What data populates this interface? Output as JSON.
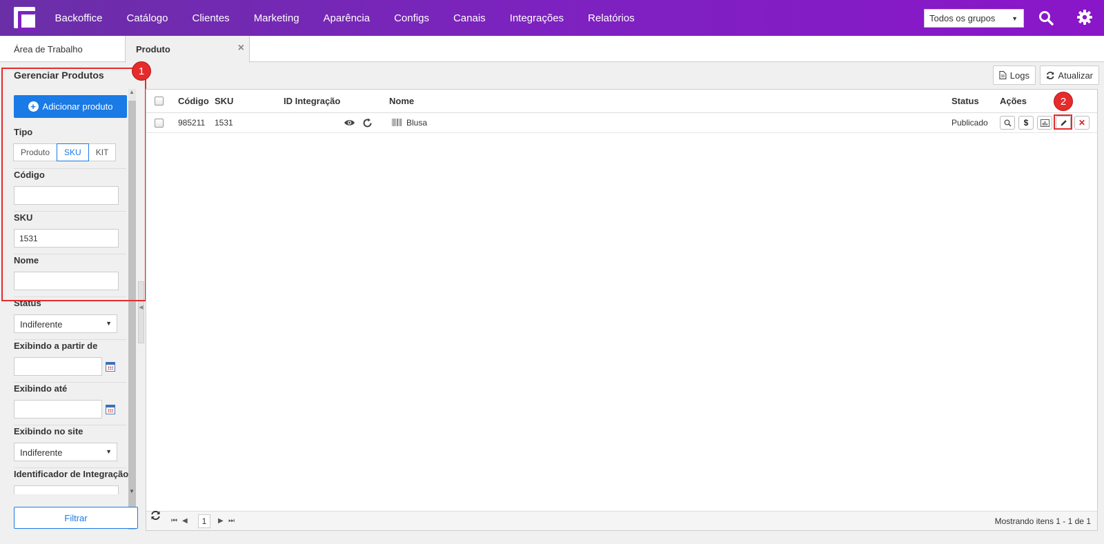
{
  "topnav": {
    "items": [
      "Backoffice",
      "Catálogo",
      "Clientes",
      "Marketing",
      "Aparência",
      "Configs",
      "Canais",
      "Integrações",
      "Relatórios"
    ],
    "group_select": "Todos os grupos",
    "icons": [
      "logo-icon",
      "search-icon",
      "gear-icon"
    ]
  },
  "tabs": [
    {
      "label": "Área de Trabalho"
    },
    {
      "label": "Produto",
      "active": true,
      "close": "×"
    }
  ],
  "sidebar": {
    "title": "Gerenciar Produtos",
    "add_button": "Adicionar produto",
    "tipo_label": "Tipo",
    "tipo_options": [
      "Produto",
      "SKU",
      "KIT"
    ],
    "tipo_selected": "SKU",
    "codigo_label": "Código",
    "codigo_value": "",
    "sku_label": "SKU",
    "sku_value": "1531",
    "nome_label": "Nome",
    "nome_value": "",
    "status_label": "Status",
    "status_value": "Indiferente",
    "exibindo_de_label": "Exibindo a partir de",
    "exibindo_ate_label": "Exibindo até",
    "exibindo_site_label": "Exibindo no site",
    "exibindo_site_value": "Indiferente",
    "integracao_label": "Identificador de Integração",
    "filter_button": "Filtrar"
  },
  "toolbar": {
    "logs": "Logs",
    "refresh": "Atualizar"
  },
  "grid": {
    "columns": [
      "Código",
      "SKU",
      "ID Integração",
      "Nome",
      "Status",
      "Ações"
    ],
    "rows": [
      {
        "codigo": "985211",
        "sku": "1531",
        "id_integracao": "",
        "nome": "Blusa",
        "status": "Publicado"
      }
    ],
    "pager": {
      "current": "1",
      "info": "Mostrando itens 1 - 1 de 1"
    }
  },
  "annotations": {
    "badge1": "1",
    "badge2": "2"
  },
  "colors": {
    "nav_start": "#6a2fa7",
    "nav_end": "#8a16c9",
    "primary": "#1a7ae6",
    "highlight": "#e52b2b"
  }
}
